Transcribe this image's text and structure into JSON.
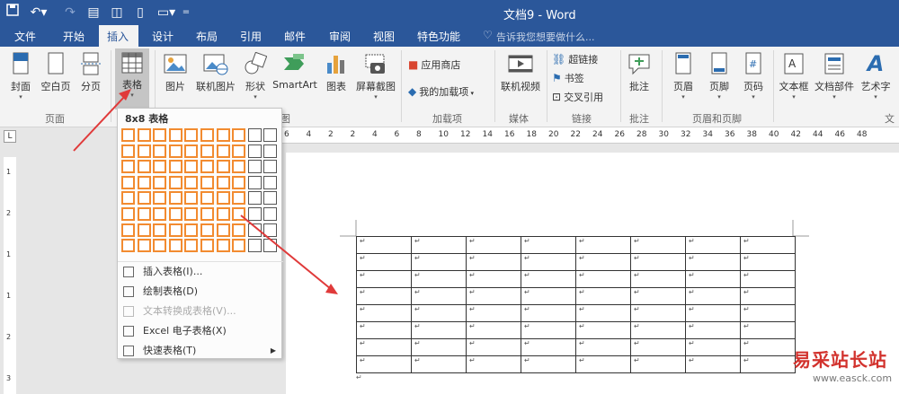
{
  "quick_access": {
    "save": "save-icon",
    "undo": "undo-icon",
    "redo": "redo-icon"
  },
  "window_title": "文档9 - Word",
  "tabs": [
    "文件",
    "开始",
    "插入",
    "设计",
    "布局",
    "引用",
    "邮件",
    "审阅",
    "视图",
    "特色功能"
  ],
  "tell_me": "告诉我您想要做什么...",
  "ribbon": {
    "pages_group": {
      "label": "页面",
      "buttons": [
        "封面",
        "空白页",
        "分页"
      ]
    },
    "table_button": "表格",
    "illustrations": [
      "图片",
      "联机图片",
      "形状",
      "SmartArt",
      "图表",
      "屏幕截图"
    ],
    "addins": {
      "label": "加载项",
      "store": "应用商店",
      "my_addins": "我的加载项"
    },
    "media": {
      "label": "媒体",
      "online_video": "联机视频"
    },
    "links": {
      "label": "链接",
      "hyperlink": "超链接",
      "bookmark": "书签",
      "cross_ref": "交叉引用"
    },
    "comments": {
      "label": "批注",
      "comment": "批注"
    },
    "header_footer": {
      "label": "页眉和页脚",
      "buttons": [
        "页眉",
        "页脚",
        "页码"
      ]
    },
    "text": {
      "label": "文本",
      "buttons": [
        "文本框",
        "文档部件",
        "艺术字"
      ]
    }
  },
  "table_dropdown": {
    "grid_title": "8x8 表格",
    "grid_cols": 10,
    "grid_rows": 8,
    "selected_cols": 8,
    "selected_rows": 8,
    "menu": [
      {
        "label": "插入表格(I)...",
        "icon": "insert-table-icon",
        "disabled": false
      },
      {
        "label": "绘制表格(D)",
        "icon": "draw-table-icon",
        "disabled": false
      },
      {
        "label": "文本转换成表格(V)...",
        "icon": "convert-text-icon",
        "disabled": true
      },
      {
        "label": "Excel 电子表格(X)",
        "icon": "excel-icon",
        "disabled": false
      },
      {
        "label": "快速表格(T)",
        "icon": "quick-table-icon",
        "disabled": false,
        "submenu": true
      }
    ]
  },
  "ruler_ticks": [
    "6",
    "4",
    "2",
    "2",
    "4",
    "6",
    "8",
    "10",
    "12",
    "14",
    "16",
    "18",
    "20",
    "22",
    "24",
    "26",
    "28",
    "30",
    "32",
    "34",
    "36",
    "38",
    "40",
    "42",
    "44",
    "46",
    "48"
  ],
  "vruler_ticks": [
    "1",
    "2",
    "1",
    "1",
    "2",
    "3"
  ],
  "doc_table": {
    "rows": 8,
    "cols": 8,
    "cell_mark": "↵"
  },
  "watermark": {
    "cn": "易采站长站",
    "en": "www.easck.com"
  }
}
